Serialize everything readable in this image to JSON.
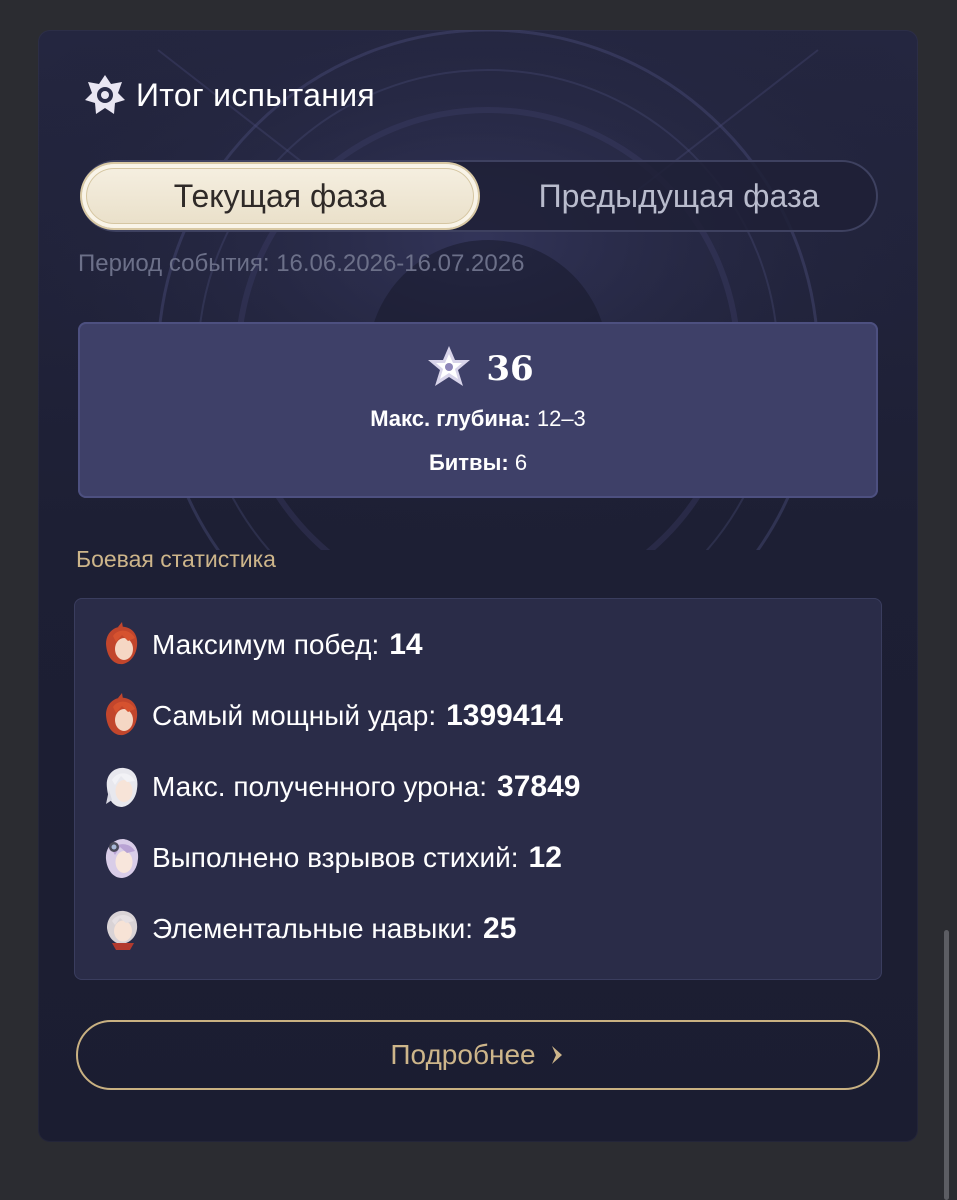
{
  "header": {
    "title": "Итог испытания",
    "icon": "abyss-emblem-icon"
  },
  "tabs": [
    {
      "label": "Текущая фаза",
      "active": true
    },
    {
      "label": "Предыдущая фаза",
      "active": false
    }
  ],
  "period": "Период события: 16.06.2026-16.07.2026",
  "summary": {
    "stars": "36",
    "star_icon": "abyss-star-icon",
    "max_depth_label": "Макс. глубина:",
    "max_depth_value": "12–3",
    "battles_label": "Битвы:",
    "battles_value": "6"
  },
  "section_title": "Боевая статистика",
  "stats": [
    {
      "label": "Максимум побед:",
      "value": "14",
      "avatar": "red-hair-character-avatar"
    },
    {
      "label": "Самый мощный удар:",
      "value": "1399414",
      "avatar": "red-hair-character-avatar"
    },
    {
      "label": "Макс. полученного урона:",
      "value": "37849",
      "avatar": "white-hair-character-avatar"
    },
    {
      "label": "Выполнено взрывов стихий:",
      "value": "12",
      "avatar": "purple-hair-character-avatar"
    },
    {
      "label": "Элементальные навыки:",
      "value": "25",
      "avatar": "silver-hair-character-avatar"
    }
  ],
  "more_button": {
    "label": "Подробнее",
    "icon": "chevron-right-icon"
  },
  "colors": {
    "page_bg": "#2b2c31",
    "card_bg": "#1d1f34",
    "summary_bg": "#3e4068",
    "stats_bg": "#2a2c48",
    "accent_gold": "#cdb58a",
    "tab_active_bg": "#f0e8d6"
  }
}
